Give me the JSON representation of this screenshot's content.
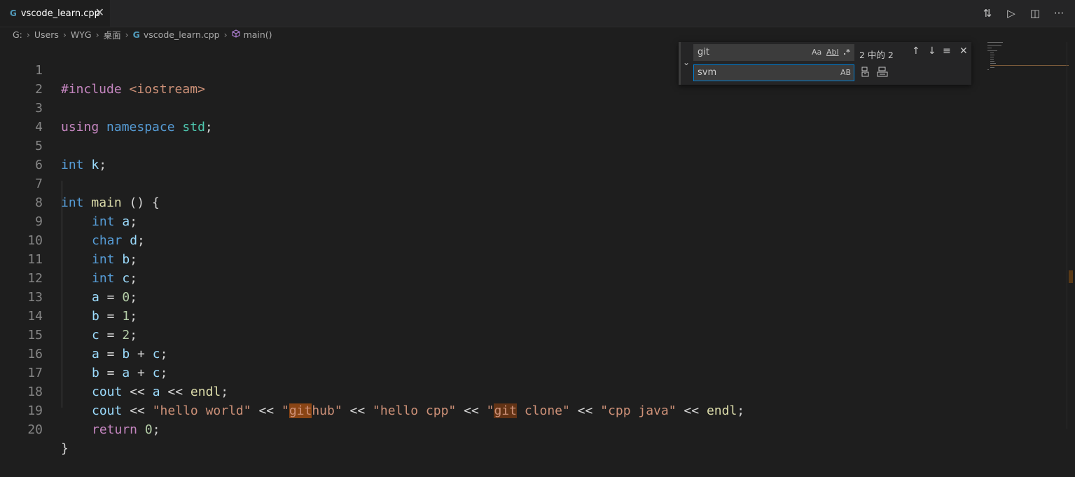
{
  "tab": {
    "icon_text": "G",
    "title": "vscode_learn.cpp",
    "close_glyph": "✕"
  },
  "title_actions": {
    "compare": "⇅",
    "run": "▷",
    "split": "◫",
    "more": "···"
  },
  "breadcrumb": {
    "drive": "G:",
    "users": "Users",
    "user": "WYG",
    "desktop": "桌面",
    "file_icon_text": "G",
    "file": "vscode_learn.cpp",
    "symbol": "main()"
  },
  "find_widget": {
    "search_value": "git",
    "replace_value": "svm",
    "match_case_label": "Aa",
    "whole_word_label": "Abl",
    "regex_label": ".*",
    "preserve_case_label": "AB",
    "count_text": "2 中的 2",
    "prev_glyph": "↑",
    "next_glyph": "↓",
    "in_selection_glyph": "≡",
    "close_glyph": "✕",
    "toggle_glyph": "⌄"
  },
  "lines": {
    "l1": {
      "n": "1",
      "a": "#include",
      "b": " <iostream>"
    },
    "l2": {
      "n": "2"
    },
    "l3": {
      "n": "3",
      "a": "using",
      "b": " namespace",
      "c": " std",
      "d": ";"
    },
    "l4": {
      "n": "4"
    },
    "l5": {
      "n": "5",
      "a": "int",
      "b": " k",
      "c": ";"
    },
    "l6": {
      "n": "6"
    },
    "l7": {
      "n": "7",
      "a": "int",
      "b": " main",
      "c": " ()",
      "d": " {"
    },
    "l8": {
      "n": "8",
      "a": "int",
      "b": " a",
      "c": ";"
    },
    "l9": {
      "n": "9",
      "a": "char",
      "b": " d",
      "c": ";"
    },
    "l10": {
      "n": "10",
      "a": "int",
      "b": " b",
      "c": ";"
    },
    "l11": {
      "n": "11",
      "a": "int",
      "b": " c",
      "c": ";"
    },
    "l12": {
      "n": "12",
      "a": "a",
      "b": " = ",
      "c": "0",
      "d": ";"
    },
    "l13": {
      "n": "13",
      "a": "b",
      "b": " = ",
      "c": "1",
      "d": ";"
    },
    "l14": {
      "n": "14",
      "a": "c",
      "b": " = ",
      "c": "2",
      "d": ";"
    },
    "l15": {
      "n": "15",
      "a": "a",
      "b": " = ",
      "c": "b",
      "d": " + ",
      "e": "c",
      "f": ";"
    },
    "l16": {
      "n": "16",
      "a": "b",
      "b": " = ",
      "c": "a",
      "d": " + ",
      "e": "c",
      "f": ";"
    },
    "l17": {
      "n": "17",
      "a": "cout",
      "b": " << ",
      "c": "a",
      "d": " << ",
      "e": "endl",
      "f": ";"
    },
    "l18": {
      "n": "18",
      "a": "cout",
      "b": " << ",
      "c": "\"hello world\"",
      "d": " << ",
      "e1": "\"",
      "e2": "git",
      "e3": "hub\"",
      "f": " << ",
      "g": "\"hello cpp\"",
      "h": " << ",
      "i1": "\"",
      "i2": "git",
      "i3": " clone\"",
      "j": " << ",
      "k": "\"cpp java\"",
      "l": " << ",
      "m": "endl",
      "o": ";"
    },
    "l19": {
      "n": "19",
      "a": "return",
      "b": " ",
      "c": "0",
      "d": ";"
    },
    "l20": {
      "n": "20",
      "a": "}"
    }
  },
  "colors": {
    "keyword": "#569cd6",
    "control": "#c586c0",
    "namespace": "#4ec9b0",
    "variable": "#9cdcfe",
    "function": "#dcdcaa",
    "string": "#ce9178",
    "number": "#b5cea8",
    "match_highlight": "#623315"
  }
}
